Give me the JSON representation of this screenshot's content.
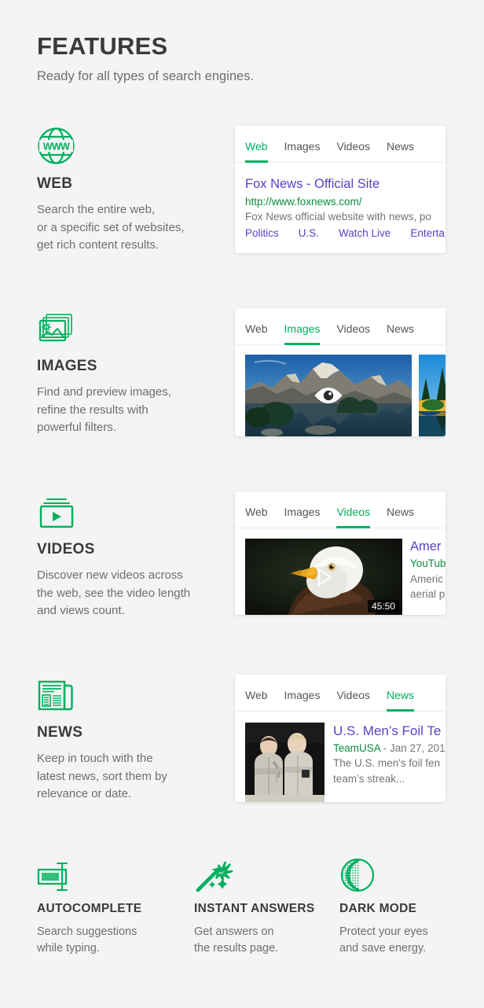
{
  "header": {
    "title": "FEATURES",
    "subtitle": "Ready for all types of search engines."
  },
  "accent_color": "#00b05f",
  "background_color": "#f4f4f4",
  "link_color": "#5940c8",
  "url_color": "#0a8a3e",
  "tabs": [
    "Web",
    "Images",
    "Videos",
    "News"
  ],
  "features": [
    {
      "icon": "globe-www-icon",
      "title": "WEB",
      "desc_lines": [
        "Search the entire web,",
        "or a specific set of websites,",
        "get rich content results."
      ],
      "active_tab": "Web",
      "result": {
        "kind": "web",
        "title": "Fox News - Official Site",
        "url": "http://www.foxnews.com/",
        "snippet": "Fox News official website with news, po",
        "sitelinks": [
          "Politics",
          "U.S.",
          "Watch Live",
          "Enterta"
        ]
      }
    },
    {
      "icon": "image-stack-icon",
      "title": "IMAGES",
      "desc_lines": [
        "Find and preview images,",
        "refine the results with",
        "powerful filters."
      ],
      "active_tab": "Images",
      "result": {
        "kind": "images",
        "overlay_icon": "eye-icon",
        "thumb1_alt": "mountain lake reflection",
        "thumb2_alt": "pine trees by lake"
      }
    },
    {
      "icon": "video-player-icon",
      "title": "VIDEOS",
      "desc_lines": [
        "Discover new videos across",
        "the web, see the video length",
        "and views count."
      ],
      "active_tab": "Videos",
      "result": {
        "kind": "video",
        "title": "Amer",
        "source": "YouTub",
        "desc_lines": [
          "Americ",
          "aerial p"
        ],
        "duration": "45:50",
        "play_icon": "play-icon",
        "thumb_alt": "bald eagle"
      }
    },
    {
      "icon": "newspaper-icon",
      "title": "NEWS",
      "desc_lines": [
        "Keep in touch with the",
        "latest news, sort them by",
        "relevance or date."
      ],
      "active_tab": "News",
      "result": {
        "kind": "news",
        "title": "U.S. Men’s Foil Te",
        "source": "TeamUSA",
        "date": " - Jan 27, 201",
        "desc_lines": [
          "The U.S. men's foil fen",
          "team’s streak..."
        ],
        "thumb_alt": "two fencers"
      }
    }
  ],
  "bottom_features": [
    {
      "icon": "autocomplete-field-icon",
      "title": "AUTOCOMPLETE",
      "desc_lines": [
        "Search suggestions",
        "while typing."
      ]
    },
    {
      "icon": "magic-wand-icon",
      "title": "INSTANT ANSWERS",
      "desc_lines": [
        "Get answers on",
        "the results page."
      ]
    },
    {
      "icon": "dark-mode-circle-icon",
      "title": "DARK MODE",
      "desc_lines": [
        "Protect your eyes",
        "and save energy."
      ]
    }
  ]
}
